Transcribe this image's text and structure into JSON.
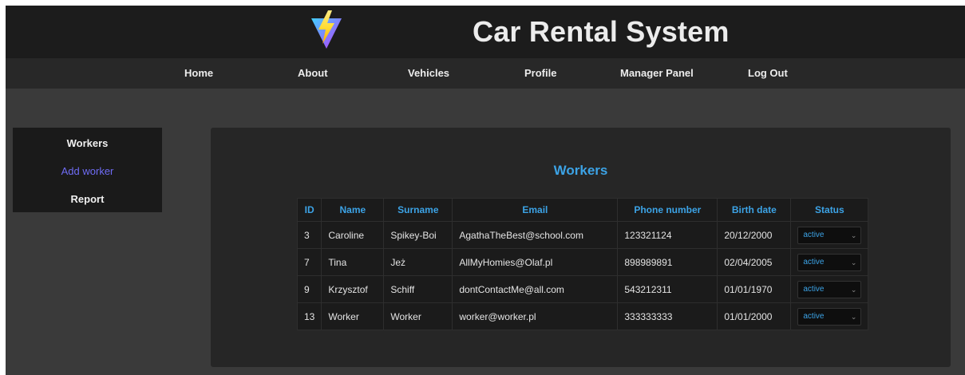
{
  "header": {
    "title": "Car Rental System",
    "logo_icon": "vite-lightning-logo"
  },
  "nav": {
    "items": [
      {
        "label": "Home"
      },
      {
        "label": "About"
      },
      {
        "label": "Vehicles"
      },
      {
        "label": "Profile"
      },
      {
        "label": "Manager Panel"
      },
      {
        "label": "Log Out"
      }
    ]
  },
  "sidebar": {
    "items": [
      {
        "label": "Workers",
        "active": false
      },
      {
        "label": "Add worker",
        "active": true
      },
      {
        "label": "Report",
        "active": false
      }
    ]
  },
  "main": {
    "title": "Workers",
    "table": {
      "columns": [
        "ID",
        "Name",
        "Surname",
        "Email",
        "Phone number",
        "Birth date",
        "Status"
      ],
      "rows": [
        {
          "id": "3",
          "name": "Caroline",
          "surname": "Spikey-Boi",
          "email": "AgathaTheBest@school.com",
          "phone": "123321124",
          "birth_date": "20/12/2000",
          "status": "active"
        },
        {
          "id": "7",
          "name": "Tina",
          "surname": "Jeż",
          "email": "AllMyHomies@Olaf.pl",
          "phone": "898989891",
          "birth_date": "02/04/2005",
          "status": "active"
        },
        {
          "id": "9",
          "name": "Krzysztof",
          "surname": "Schiff",
          "email": "dontContactMe@all.com",
          "phone": "543212311",
          "birth_date": "01/01/1970",
          "status": "active"
        },
        {
          "id": "13",
          "name": "Worker",
          "surname": "Worker",
          "email": "worker@worker.pl",
          "phone": "333333333",
          "birth_date": "01/01/2000",
          "status": "active"
        }
      ]
    }
  },
  "colors": {
    "accent_blue": "#3ca3e6",
    "active_link": "#6f6cf5",
    "header_bg": "#1c1c1c",
    "page_bg": "#3a3a3a"
  }
}
